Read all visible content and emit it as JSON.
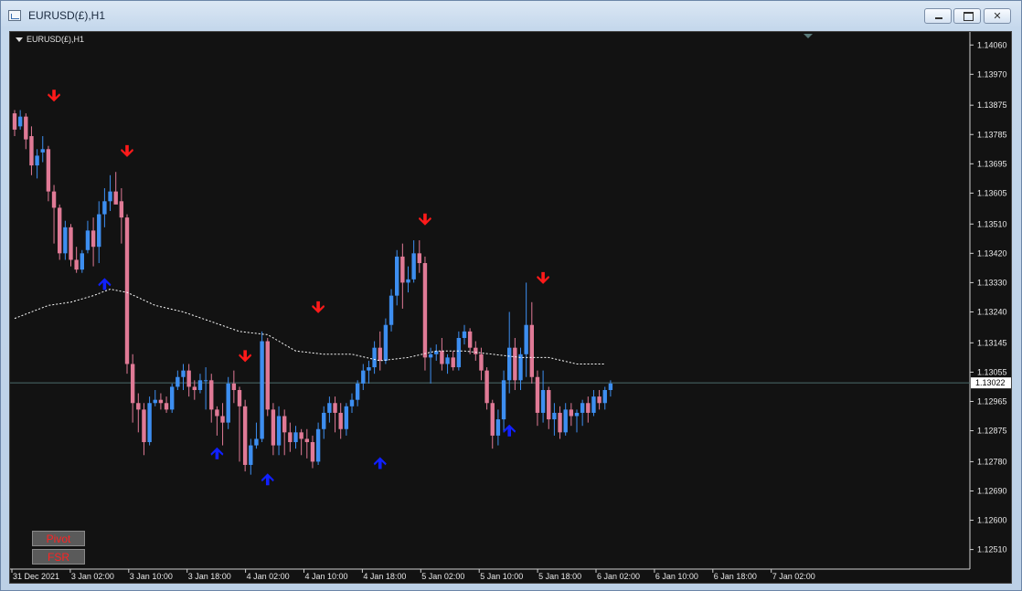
{
  "window": {
    "title": "EURUSD(£),H1"
  },
  "chart": {
    "symbol_label": "EURUSD(£),H1",
    "current_price": "1.13022"
  },
  "buttons": {
    "pivot": "Pivot",
    "fsr": "FSR"
  },
  "colors": {
    "background": "#121212",
    "bull": "#3d8ef0",
    "bear": "#e07a96",
    "arrow_down": "#ff1a1a",
    "arrow_up": "#1020ff",
    "ma": "#ffffff"
  },
  "chart_data": {
    "type": "candlestick",
    "ylim": [
      1.1245,
      1.141
    ],
    "y_ticks": [
      "1.14060",
      "1.13970",
      "1.13875",
      "1.13785",
      "1.13695",
      "1.13605",
      "1.13510",
      "1.13420",
      "1.13330",
      "1.13240",
      "1.13145",
      "1.13055",
      "1.12965",
      "1.12875",
      "1.12780",
      "1.12690",
      "1.12600",
      "1.12510"
    ],
    "x_ticks": [
      "31 Dec 2021",
      "3 Jan 02:00",
      "3 Jan 10:00",
      "3 Jan 18:00",
      "4 Jan 02:00",
      "4 Jan 10:00",
      "4 Jan 18:00",
      "5 Jan 02:00",
      "5 Jan 10:00",
      "5 Jan 18:00",
      "6 Jan 02:00",
      "6 Jan 10:00",
      "6 Jan 18:00",
      "7 Jan 02:00"
    ],
    "candles": [
      [
        1.1385,
        1.1386,
        1.1378,
        1.138
      ],
      [
        1.1381,
        1.1386,
        1.138,
        1.1384
      ],
      [
        1.1384,
        1.1385,
        1.1374,
        1.1377
      ],
      [
        1.1378,
        1.1381,
        1.1366,
        1.1369
      ],
      [
        1.1369,
        1.1374,
        1.1365,
        1.1372
      ],
      [
        1.1373,
        1.1378,
        1.137,
        1.1374
      ],
      [
        1.1374,
        1.1375,
        1.1358,
        1.1361
      ],
      [
        1.1361,
        1.1363,
        1.1345,
        1.1356
      ],
      [
        1.1356,
        1.1357,
        1.134,
        1.1342
      ],
      [
        1.1342,
        1.1352,
        1.134,
        1.135
      ],
      [
        1.135,
        1.1351,
        1.1338,
        1.134
      ],
      [
        1.134,
        1.1344,
        1.1336,
        1.1337
      ],
      [
        1.1337,
        1.1343,
        1.1336,
        1.1342
      ],
      [
        1.1343,
        1.1352,
        1.1342,
        1.1349
      ],
      [
        1.1349,
        1.1353,
        1.1338,
        1.1344
      ],
      [
        1.1344,
        1.1358,
        1.1339,
        1.1354
      ],
      [
        1.1354,
        1.1362,
        1.135,
        1.1358
      ],
      [
        1.1358,
        1.1366,
        1.1355,
        1.1361
      ],
      [
        1.1361,
        1.1367,
        1.1358,
        1.1357
      ],
      [
        1.1358,
        1.1362,
        1.1345,
        1.1353
      ],
      [
        1.1353,
        1.1354,
        1.1305,
        1.1308
      ],
      [
        1.1308,
        1.1311,
        1.129,
        1.1296
      ],
      [
        1.1296,
        1.1299,
        1.1287,
        1.1294
      ],
      [
        1.1294,
        1.1296,
        1.128,
        1.1284
      ],
      [
        1.1284,
        1.1298,
        1.1283,
        1.1296
      ],
      [
        1.1296,
        1.13,
        1.1295,
        1.1297
      ],
      [
        1.1297,
        1.1299,
        1.1294,
        1.1296
      ],
      [
        1.1296,
        1.1298,
        1.1293,
        1.1294
      ],
      [
        1.1294,
        1.1302,
        1.1293,
        1.1301
      ],
      [
        1.1301,
        1.1306,
        1.13,
        1.1304
      ],
      [
        1.1304,
        1.1308,
        1.13,
        1.1306
      ],
      [
        1.1306,
        1.1308,
        1.1298,
        1.1301
      ],
      [
        1.1301,
        1.1303,
        1.1297,
        1.13
      ],
      [
        1.13,
        1.1305,
        1.1299,
        1.1303
      ],
      [
        1.1303,
        1.1307,
        1.1294,
        1.1303
      ],
      [
        1.1303,
        1.1305,
        1.129,
        1.1294
      ],
      [
        1.1294,
        1.1295,
        1.1286,
        1.1292
      ],
      [
        1.1292,
        1.1296,
        1.1283,
        1.129
      ],
      [
        1.129,
        1.1304,
        1.1288,
        1.1302
      ],
      [
        1.1302,
        1.1306,
        1.1296,
        1.13
      ],
      [
        1.13,
        1.1301,
        1.1278,
        1.1295
      ],
      [
        1.1295,
        1.1297,
        1.1275,
        1.1277
      ],
      [
        1.1277,
        1.1285,
        1.1274,
        1.1283
      ],
      [
        1.1283,
        1.129,
        1.1282,
        1.1285
      ],
      [
        1.1285,
        1.1318,
        1.1284,
        1.1315
      ],
      [
        1.1315,
        1.1316,
        1.1292,
        1.1294
      ],
      [
        1.1294,
        1.1296,
        1.128,
        1.1283
      ],
      [
        1.1283,
        1.1295,
        1.128,
        1.1292
      ],
      [
        1.1292,
        1.1294,
        1.128,
        1.1287
      ],
      [
        1.1287,
        1.129,
        1.1281,
        1.1284
      ],
      [
        1.1284,
        1.1289,
        1.1282,
        1.1287
      ],
      [
        1.1287,
        1.1288,
        1.128,
        1.1285
      ],
      [
        1.1285,
        1.1288,
        1.1279,
        1.1284
      ],
      [
        1.1284,
        1.1286,
        1.1276,
        1.1278
      ],
      [
        1.1278,
        1.129,
        1.1277,
        1.1288
      ],
      [
        1.1288,
        1.1295,
        1.1285,
        1.1293
      ],
      [
        1.1293,
        1.1298,
        1.129,
        1.1296
      ],
      [
        1.1296,
        1.1298,
        1.1287,
        1.1293
      ],
      [
        1.1293,
        1.1296,
        1.1285,
        1.1288
      ],
      [
        1.1288,
        1.1296,
        1.1286,
        1.1295
      ],
      [
        1.1295,
        1.1299,
        1.1293,
        1.1297
      ],
      [
        1.1297,
        1.1303,
        1.1295,
        1.1302
      ],
      [
        1.1302,
        1.1308,
        1.13,
        1.1306
      ],
      [
        1.1306,
        1.1309,
        1.1302,
        1.1307
      ],
      [
        1.1307,
        1.1315,
        1.1305,
        1.1313
      ],
      [
        1.1313,
        1.1318,
        1.1306,
        1.1309
      ],
      [
        1.1309,
        1.1322,
        1.1308,
        1.132
      ],
      [
        1.132,
        1.1331,
        1.1318,
        1.1329
      ],
      [
        1.1329,
        1.1343,
        1.1326,
        1.1341
      ],
      [
        1.1341,
        1.1345,
        1.1325,
        1.1333
      ],
      [
        1.1333,
        1.1338,
        1.133,
        1.1334
      ],
      [
        1.1334,
        1.1346,
        1.1333,
        1.1342
      ],
      [
        1.1342,
        1.1346,
        1.1336,
        1.1339
      ],
      [
        1.1339,
        1.1341,
        1.1306,
        1.131
      ],
      [
        1.131,
        1.1313,
        1.1302,
        1.1311
      ],
      [
        1.1311,
        1.1314,
        1.1309,
        1.1312
      ],
      [
        1.1312,
        1.1316,
        1.1306,
        1.1308
      ],
      [
        1.1308,
        1.1311,
        1.1305,
        1.131
      ],
      [
        1.131,
        1.1312,
        1.1306,
        1.1307
      ],
      [
        1.1307,
        1.1318,
        1.1306,
        1.1316
      ],
      [
        1.1316,
        1.132,
        1.1314,
        1.1318
      ],
      [
        1.1318,
        1.1319,
        1.1311,
        1.1313
      ],
      [
        1.1313,
        1.1315,
        1.1309,
        1.1311
      ],
      [
        1.1311,
        1.1313,
        1.1303,
        1.1306
      ],
      [
        1.1306,
        1.1307,
        1.1294,
        1.1296
      ],
      [
        1.1296,
        1.1297,
        1.1282,
        1.1286
      ],
      [
        1.1286,
        1.1294,
        1.1283,
        1.1291
      ],
      [
        1.1291,
        1.1306,
        1.1287,
        1.1303
      ],
      [
        1.1303,
        1.1324,
        1.1299,
        1.1313
      ],
      [
        1.1313,
        1.1316,
        1.13,
        1.1303
      ],
      [
        1.1303,
        1.1313,
        1.13,
        1.1311
      ],
      [
        1.1311,
        1.1333,
        1.1304,
        1.132
      ],
      [
        1.132,
        1.1327,
        1.1302,
        1.1304
      ],
      [
        1.1304,
        1.1306,
        1.1289,
        1.1293
      ],
      [
        1.1293,
        1.1306,
        1.129,
        1.13
      ],
      [
        1.13,
        1.1301,
        1.1288,
        1.1291
      ],
      [
        1.1291,
        1.1296,
        1.1286,
        1.1293
      ],
      [
        1.1293,
        1.1295,
        1.1285,
        1.1287
      ],
      [
        1.1287,
        1.1296,
        1.1286,
        1.1294
      ],
      [
        1.1294,
        1.1296,
        1.1289,
        1.1292
      ],
      [
        1.1292,
        1.1294,
        1.1287,
        1.1293
      ],
      [
        1.1293,
        1.1297,
        1.1289,
        1.1296
      ],
      [
        1.1296,
        1.1298,
        1.129,
        1.1293
      ],
      [
        1.1293,
        1.13,
        1.1292,
        1.1298
      ],
      [
        1.1298,
        1.13,
        1.1294,
        1.1296
      ],
      [
        1.1296,
        1.1301,
        1.1294,
        1.13
      ],
      [
        1.13,
        1.1303,
        1.1298,
        1.1302
      ]
    ],
    "ma": [
      [
        0,
        1.1322
      ],
      [
        3,
        1.1324
      ],
      [
        6,
        1.1326
      ],
      [
        10,
        1.1327
      ],
      [
        14,
        1.1329
      ],
      [
        17,
        1.1331
      ],
      [
        20,
        1.133
      ],
      [
        25,
        1.1326
      ],
      [
        30,
        1.1324
      ],
      [
        35,
        1.1321
      ],
      [
        40,
        1.1318
      ],
      [
        45,
        1.1317
      ],
      [
        50,
        1.1312
      ],
      [
        55,
        1.1311
      ],
      [
        60,
        1.1311
      ],
      [
        65,
        1.1309
      ],
      [
        70,
        1.131
      ],
      [
        75,
        1.1312
      ],
      [
        80,
        1.1312
      ],
      [
        85,
        1.1311
      ],
      [
        90,
        1.131
      ],
      [
        95,
        1.131
      ],
      [
        100,
        1.1308
      ],
      [
        105,
        1.1308
      ]
    ],
    "arrows_down": [
      [
        7,
        1.139
      ],
      [
        20,
        1.1373
      ],
      [
        41,
        1.131
      ],
      [
        54,
        1.1325
      ],
      [
        73,
        1.1352
      ],
      [
        94,
        1.1334
      ]
    ],
    "arrows_up": [
      [
        16,
        1.1333
      ],
      [
        36,
        1.1281
      ],
      [
        45,
        1.1273
      ],
      [
        65,
        1.1278
      ],
      [
        88,
        1.1288
      ]
    ]
  }
}
